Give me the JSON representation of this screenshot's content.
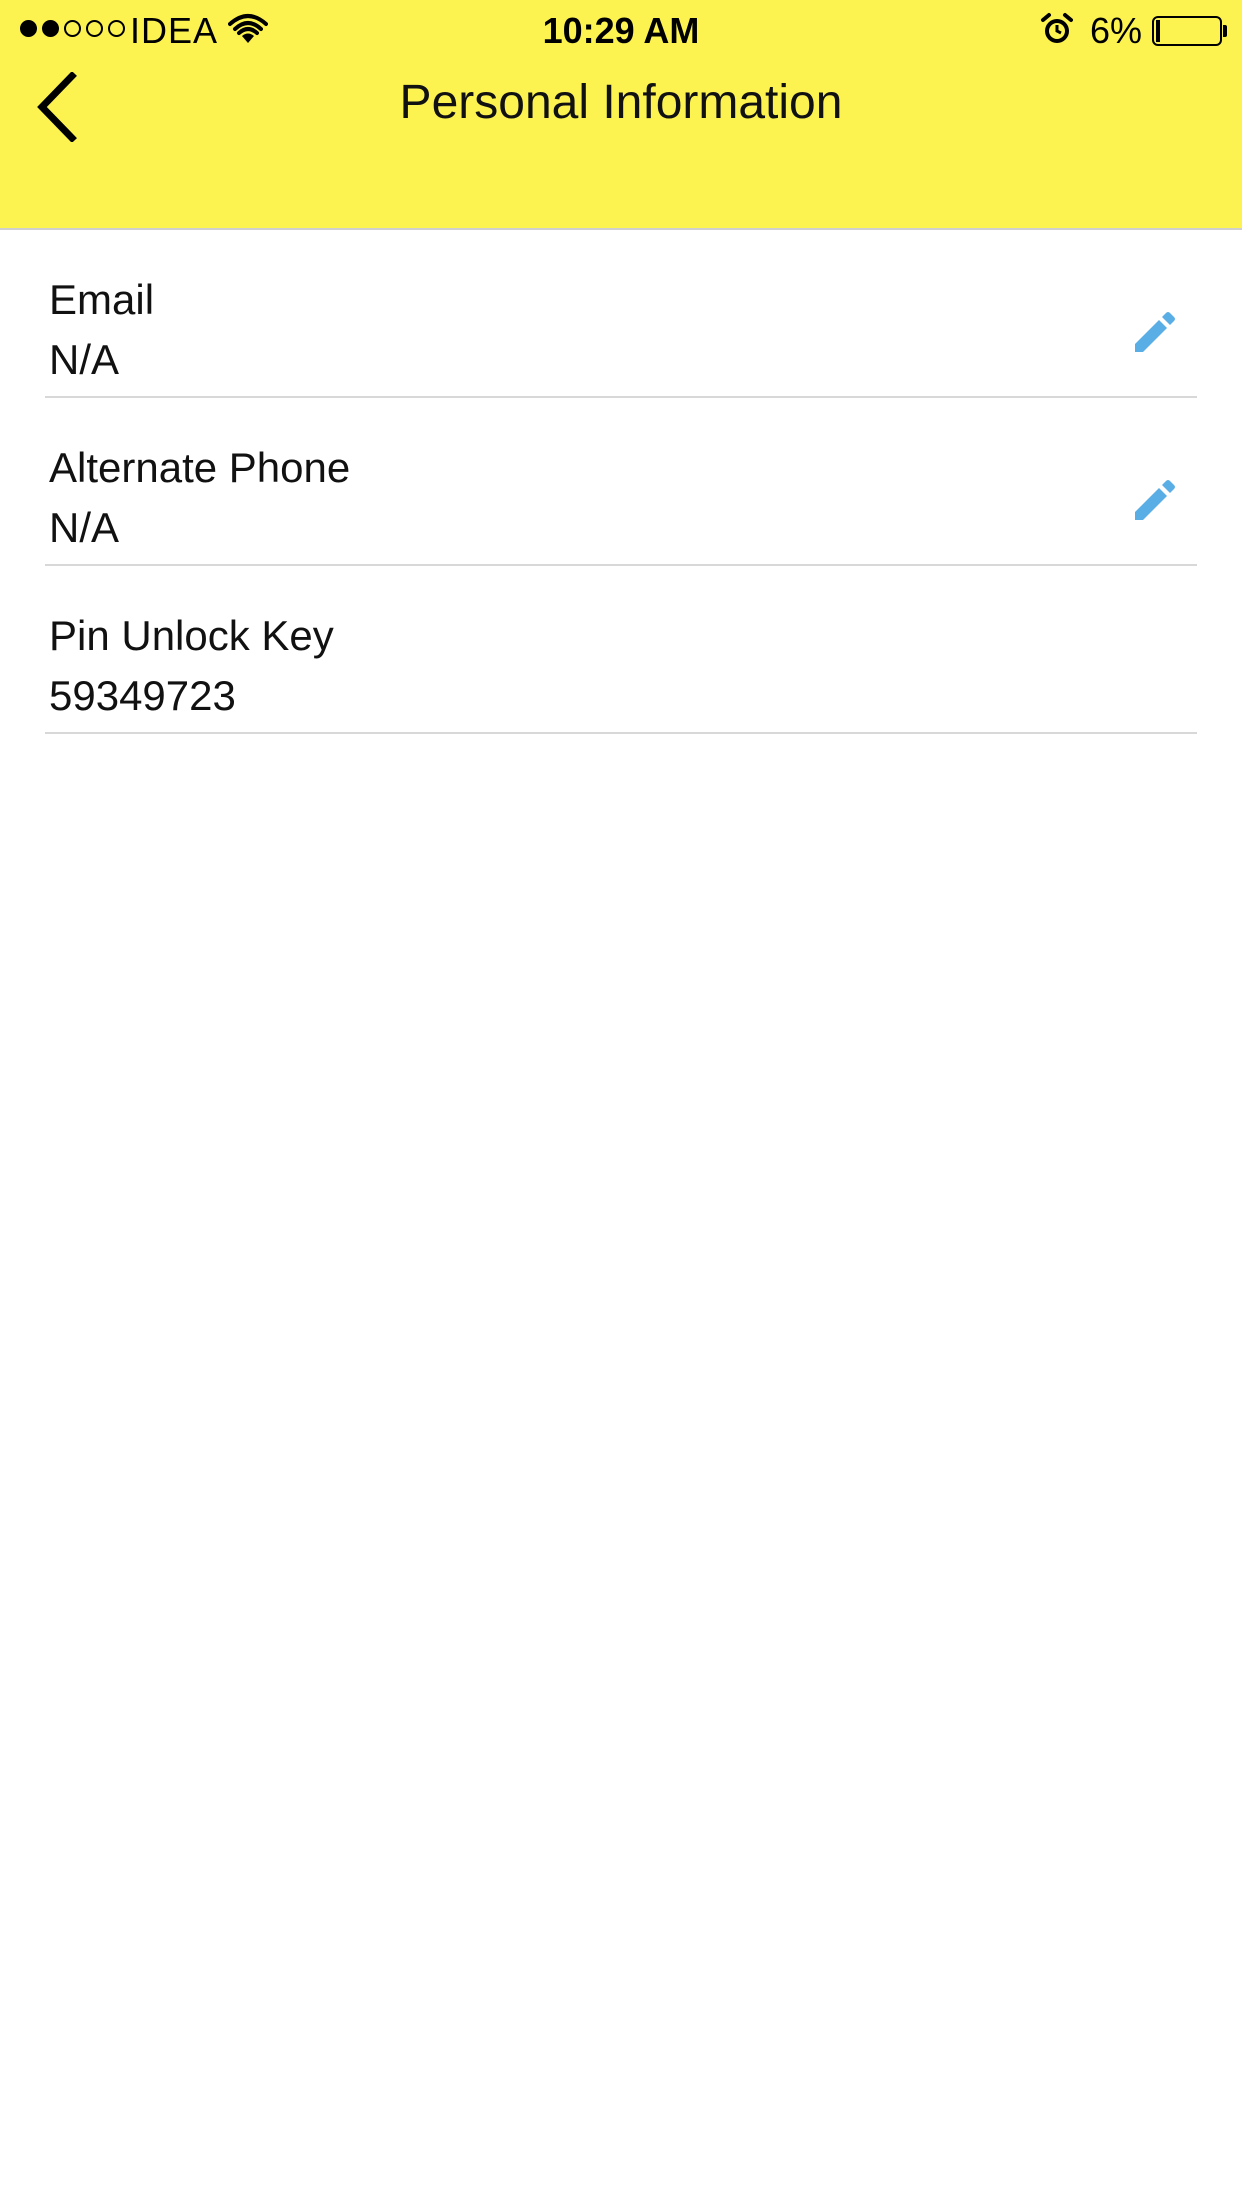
{
  "status_bar": {
    "carrier": "IDEA",
    "time": "10:29 AM",
    "battery_percent": "6%",
    "battery_level": 0.06,
    "signal_strength": 2,
    "signal_max": 5,
    "icons": [
      "wifi-icon",
      "alarm-icon",
      "battery-icon"
    ]
  },
  "nav": {
    "title": "Personal Information",
    "back_icon": "chevron-left-icon"
  },
  "fields": [
    {
      "label": "Email",
      "value": "N/A",
      "editable": true
    },
    {
      "label": "Alternate Phone",
      "value": "N/A",
      "editable": true
    },
    {
      "label": "Pin Unlock Key",
      "value": "59349723",
      "editable": false
    }
  ],
  "colors": {
    "header_background": "#fcf350",
    "edit_icon": "#5aaee6",
    "divider": "#d8d8d8"
  }
}
